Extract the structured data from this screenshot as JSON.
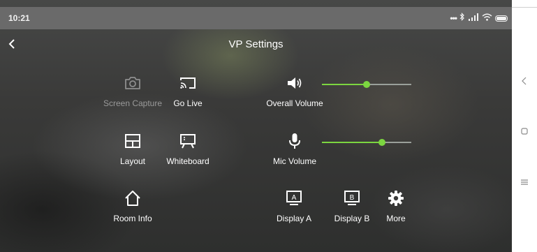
{
  "status_bar": {
    "time": "10:21",
    "icons": [
      "more-dots-icon",
      "bluetooth-icon",
      "signal-icon",
      "wifi-icon",
      "battery-icon"
    ]
  },
  "header": {
    "title": "VP Settings",
    "back_icon": "chevron-left-icon"
  },
  "controls": {
    "screen_capture": {
      "label": "Screen Capture",
      "icon": "camera-icon",
      "enabled": false
    },
    "go_live": {
      "label": "Go Live",
      "icon": "cast-icon"
    },
    "layout": {
      "label": "Layout",
      "icon": "layout-grid-icon"
    },
    "whiteboard": {
      "label": "Whiteboard",
      "icon": "whiteboard-icon"
    },
    "room_info": {
      "label": "Room Info",
      "icon": "home-icon"
    },
    "display_a": {
      "label": "Display A",
      "icon": "monitor-a-icon",
      "badge": "A"
    },
    "display_b": {
      "label": "Display B",
      "icon": "monitor-b-icon",
      "badge": "B"
    },
    "more": {
      "label": "More",
      "icon": "gear-icon"
    }
  },
  "volume": {
    "overall": {
      "label": "Overall Volume",
      "icon": "speaker-icon",
      "level": 0.5
    },
    "mic": {
      "label": "Mic Volume",
      "icon": "microphone-icon",
      "level": 0.67
    }
  },
  "nav_bar": {
    "icons": [
      "back-icon",
      "home-square-icon",
      "menu-icon"
    ]
  },
  "colors": {
    "accent": "#7cd640",
    "status_bar": "#6a6a6a",
    "disabled_text": "#9a9a9a"
  }
}
